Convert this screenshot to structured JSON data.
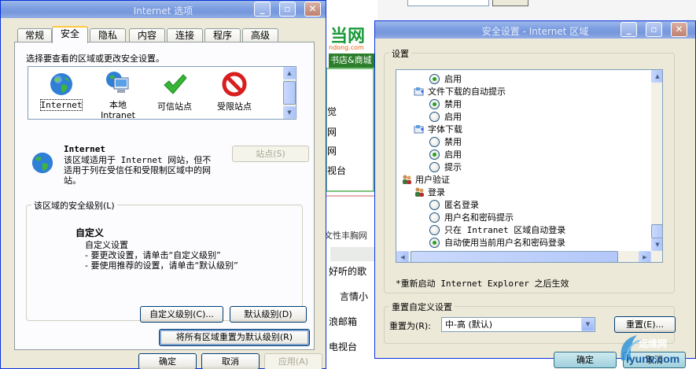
{
  "bg": {
    "logo_big": "当网",
    "logo_small": "ndong.com",
    "logo_bar": "书店&商城",
    "lines": [
      "觉",
      "网",
      "网",
      "视台",
      "文性丰胸网",
      "好听的歌",
      "言情小",
      "浪邮箱",
      "电视台"
    ]
  },
  "win1": {
    "title": "Internet 选项",
    "tabs": [
      "常规",
      "安全",
      "隐私",
      "内容",
      "连接",
      "程序",
      "高级"
    ],
    "prompt": "选择要查看的区域或更改安全设置。",
    "zones": [
      {
        "label": "Internet",
        "icon": "globe-icon"
      },
      {
        "label": "本地\nIntranet",
        "icon": "computer-icon"
      },
      {
        "label": "可信站点",
        "icon": "checkmark-icon"
      },
      {
        "label": "受限站点",
        "icon": "restricted-icon"
      }
    ],
    "zone_title": "Internet",
    "zone_desc": "该区域适用于 Internet 网站，但不适用于列在受信任和受限制区域中的网站。",
    "sites_btn": "站点(S)",
    "level_group": "该区域的安全级别(L)",
    "custom_title": "自定义",
    "custom_lines": [
      "自定义设置",
      "- 要更改设置，请单击“自定义级别”",
      "- 要使用推荐的设置，请单击“默认级别”"
    ],
    "custom_level_btn": "自定义级别(C)...",
    "default_level_btn": "默认级别(D)",
    "reset_all_btn": "将所有区域重置为默认级别(R)",
    "ok": "确定",
    "cancel": "取消",
    "apply": "应用(A)"
  },
  "win2": {
    "title": "安全设置 - Internet 区域",
    "settings_group": "设置",
    "tree": [
      {
        "type": "radio",
        "checked": true,
        "label": "启用",
        "indent": 2
      },
      {
        "type": "folder",
        "label": "文件下载的自动提示",
        "indent": 1
      },
      {
        "type": "radio",
        "checked": true,
        "label": "禁用",
        "indent": 2
      },
      {
        "type": "radio",
        "checked": false,
        "label": "启用",
        "indent": 2
      },
      {
        "type": "folder",
        "label": "字体下载",
        "indent": 1
      },
      {
        "type": "radio",
        "checked": false,
        "label": "禁用",
        "indent": 2
      },
      {
        "type": "radio",
        "checked": true,
        "label": "启用",
        "indent": 2
      },
      {
        "type": "radio",
        "checked": false,
        "label": "提示",
        "indent": 2
      },
      {
        "type": "users",
        "label": "用户验证",
        "indent": 0
      },
      {
        "type": "users",
        "label": "登录",
        "indent": 1
      },
      {
        "type": "radio",
        "checked": false,
        "label": "匿名登录",
        "indent": 2
      },
      {
        "type": "radio",
        "checked": false,
        "label": "用户名和密码提示",
        "indent": 2
      },
      {
        "type": "radio",
        "checked": false,
        "label": "只在 Intranet 区域自动登录",
        "indent": 2
      },
      {
        "type": "radio",
        "checked": true,
        "label": "自动使用当前用户名和密码登录",
        "indent": 2
      }
    ],
    "note": "*重新启动 Internet Explorer 之后生效",
    "reset_group": "重置自定义设置",
    "reset_to_label": "重置为(R):",
    "reset_select_value": "中-高 (默认)",
    "reset_btn": "重置(E)...",
    "ok": "确定",
    "cancel": "取消"
  },
  "watermark": {
    "text": "iyunv.com",
    "brand": "运维网"
  }
}
